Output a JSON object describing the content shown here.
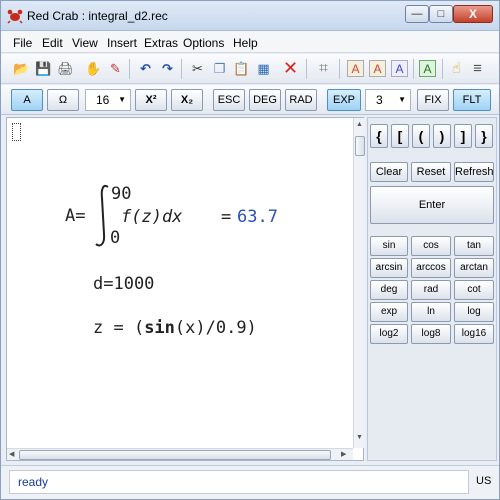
{
  "window": {
    "title": "Red Crab : integral_d2.rec"
  },
  "titlebar_buttons": {
    "minimize": "—",
    "maximize": "□",
    "close": "X"
  },
  "menu": [
    "File",
    "Edit",
    "View",
    "Insert",
    "Extras",
    "Options",
    "Help"
  ],
  "format_toolbar": {
    "a_button": "A",
    "omega_button": "Ω",
    "font_size": "16",
    "superscript": "X²",
    "subscript": "X₂",
    "esc": "ESC",
    "deg": "DEG",
    "rad": "RAD",
    "exp": "EXP",
    "precision": "3",
    "fix": "FIX",
    "flt": "FLT"
  },
  "editor": {
    "line1": {
      "lhs": "A=",
      "upper": "90",
      "lower": "0",
      "integrand": "f(z)dx",
      "equals": "=",
      "result": "63.7"
    },
    "line2": "d=1000",
    "line3": {
      "prefix": "z = (",
      "func": "sin",
      "suffix": "(x)/0.9)"
    }
  },
  "panel": {
    "brackets": [
      "{",
      "[",
      "(",
      ")",
      "]",
      "}"
    ],
    "clear": "Clear",
    "reset": "Reset",
    "refresh": "Refresh",
    "enter": "Enter",
    "functions": [
      "sin",
      "cos",
      "tan",
      "arcsin",
      "arccos",
      "arctan",
      "deg",
      "rad",
      "cot",
      "exp",
      "ln",
      "log",
      "log2",
      "log8",
      "log16"
    ]
  },
  "status": {
    "text": "ready",
    "lang": "US"
  },
  "colors": {
    "result": "#2a4fb8",
    "active_button": "#9fd2f4"
  }
}
